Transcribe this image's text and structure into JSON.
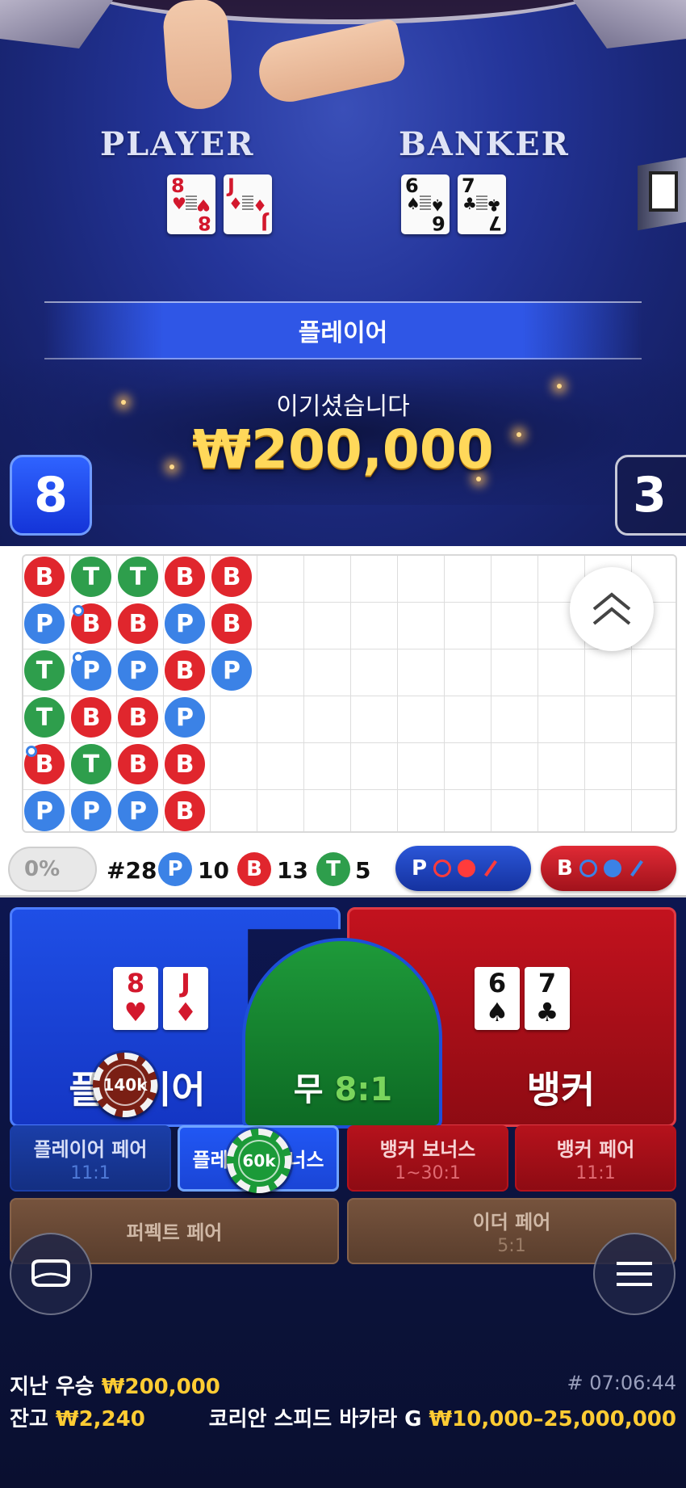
{
  "table": {
    "player_title": "PLAYER",
    "banker_title": "BANKER",
    "player_cards": [
      {
        "rank": "8",
        "suit": "♥",
        "color": "red"
      },
      {
        "rank": "J",
        "suit": "♦",
        "color": "red"
      }
    ],
    "banker_cards": [
      {
        "rank": "6",
        "suit": "♠",
        "color": "black"
      },
      {
        "rank": "7",
        "suit": "♣",
        "color": "black"
      }
    ],
    "winner_label": "플레이어",
    "win_message": "이기셨습니다",
    "win_amount": "₩200,000",
    "player_score": "8",
    "banker_score": "3"
  },
  "roadmap": {
    "columns": [
      [
        "B",
        "P",
        "T",
        "T",
        "B",
        "P"
      ],
      [
        "T",
        "B",
        "P",
        "B",
        "T",
        "P"
      ],
      [
        "T",
        "B",
        "P",
        "B",
        "B",
        "P"
      ],
      [
        "B",
        "P",
        "B",
        "P",
        "B",
        "B"
      ],
      [
        "B",
        "B",
        "P",
        "",
        "",
        ""
      ]
    ],
    "pair_markers": [
      [
        1,
        1
      ],
      [
        1,
        2
      ],
      [
        0,
        4
      ]
    ]
  },
  "stats": {
    "percent": "0%",
    "round": "#28",
    "player_letter": "P",
    "player_count": "10",
    "banker_letter": "B",
    "banker_count": "13",
    "tie_letter": "T",
    "tie_count": "5",
    "ask_player": "P",
    "ask_banker": "B"
  },
  "bets": {
    "player_label": "플레이어",
    "tie_label": "무",
    "tie_odds": "8:1",
    "banker_label": "뱅커",
    "player_chip": "140k",
    "bonus_chip": "60k",
    "side_bets": [
      {
        "label": "플레이어 페어",
        "odds": "11:1"
      },
      {
        "label": "플레이어 보너스",
        "odds": ""
      },
      {
        "label": "뱅커 보너스",
        "odds": "1~30:1"
      },
      {
        "label": "뱅커 페어",
        "odds": "11:1"
      },
      {
        "label": "퍼펙트 페어",
        "odds": ""
      },
      {
        "label": "이더 페어",
        "odds": "5:1"
      }
    ]
  },
  "footer": {
    "last_win_label": "지난 우승",
    "last_win_amount": "₩200,000",
    "balance_label": "잔고",
    "balance_amount": "₩2,240",
    "time": "# 07:06:44",
    "table_name": "코리안 스피드 바카라 G",
    "limits": "₩10,000–25,000,000"
  },
  "colors": {
    "player": "#1f4fe6",
    "banker": "#c3121e",
    "tie": "#1e9a3a",
    "gold": "#ffcc33"
  }
}
